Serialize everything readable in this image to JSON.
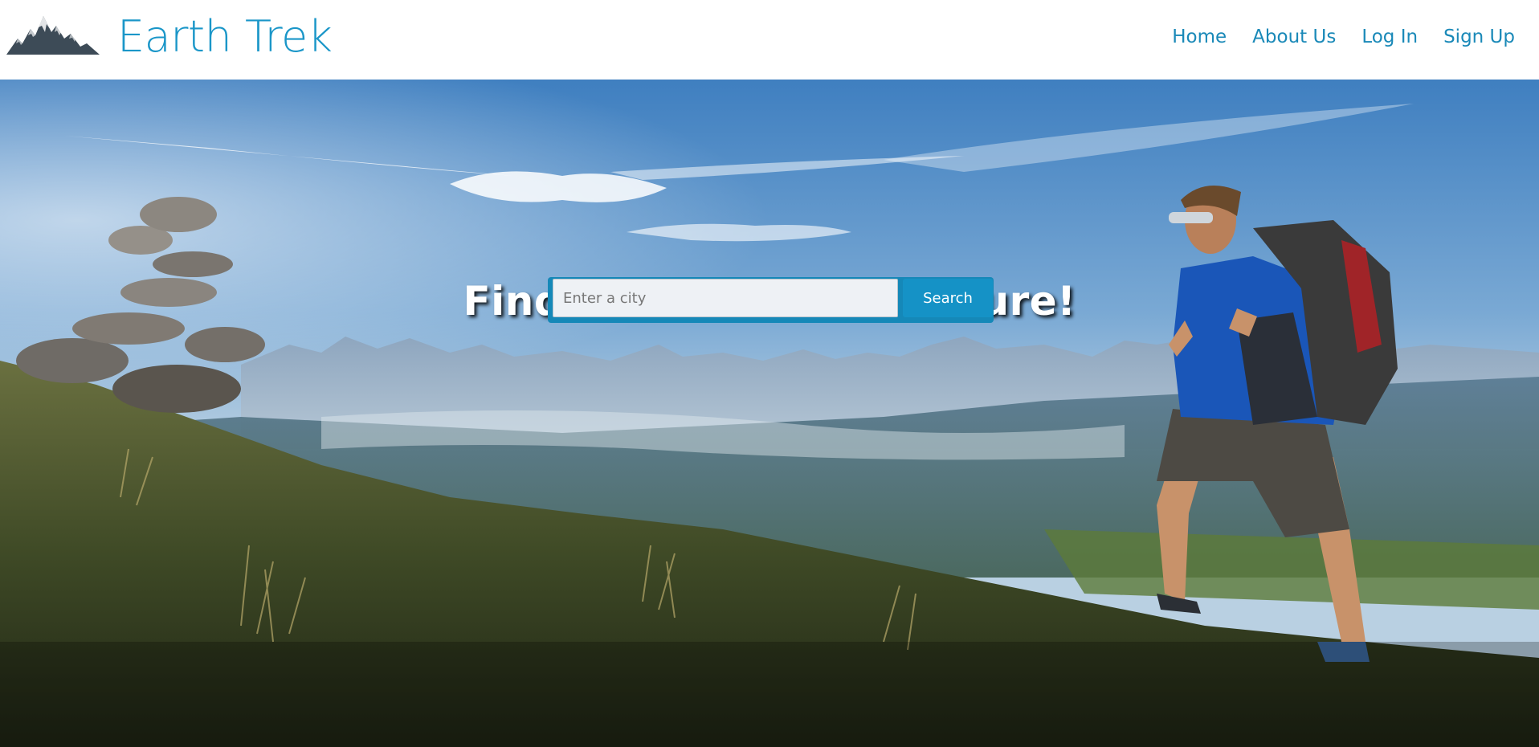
{
  "header": {
    "brand": "Earth Trek",
    "logo_icon": "mountain-logo-icon",
    "nav": [
      {
        "label": "Home"
      },
      {
        "label": "About Us"
      },
      {
        "label": "Log In"
      },
      {
        "label": "Sign Up"
      }
    ]
  },
  "hero": {
    "headline": "Find Your Next Adventure!",
    "search": {
      "placeholder": "Enter a city",
      "value": "",
      "button_label": "Search"
    },
    "background": "hiker-mountain-landscape-photo"
  },
  "colors": {
    "brand": "#1a96c8",
    "nav": "#1a89b8",
    "button": "#1592c6"
  }
}
